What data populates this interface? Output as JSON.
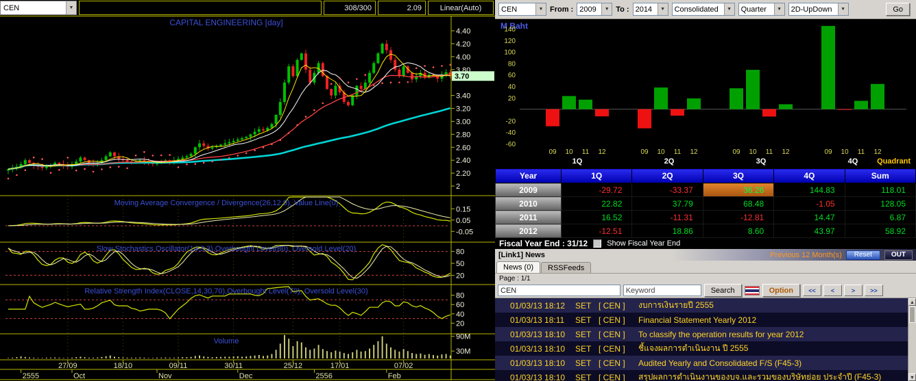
{
  "left_toolbar": {
    "symbol": "CEN",
    "range": "308/300",
    "value": "2.09",
    "scale_mode": "Linear(Auto)"
  },
  "price_chart": {
    "title": "CAPITAL ENGINEERING [day]",
    "current_price": "3.70",
    "price_ticks": [
      "4.40",
      "4.20",
      "4.00",
      "3.80",
      "3.40",
      "3.20",
      "3.00",
      "2.80",
      "2.60",
      "2.40",
      "2.20",
      "2"
    ],
    "macd_title": "Moving Average Convergence / Divergence(26,12,9), Value Line(0)",
    "macd_ticks": [
      "0.15",
      "0.05",
      "-0.05"
    ],
    "stoch_title": "Slow Stochastics Oscillator(14,3,3),Overbought Level(80), Oversold Level(20)",
    "stoch_ticks": [
      "80",
      "50",
      "20"
    ],
    "rsi_title": "Relative Strength Index(CLOSE,14,30,70),Overbought Level(70), Oversold Level(30)",
    "rsi_ticks": [
      "80",
      "60",
      "40",
      "20"
    ],
    "volume_title": "Volume",
    "volume_ticks": [
      "90M",
      "30M"
    ]
  },
  "chart_data": [
    {
      "type": "candlestick",
      "symbol": "CEN",
      "title": "CAPITAL ENGINEERING [day]",
      "last_price": 3.7,
      "ylim": [
        2.0,
        4.4
      ],
      "closes": [
        2.26,
        2.28,
        2.3,
        2.34,
        2.4,
        2.36,
        2.32,
        2.3,
        2.28,
        2.3,
        2.32,
        2.36,
        2.34,
        2.32,
        2.3,
        2.34,
        2.38,
        2.44,
        2.4,
        2.36,
        2.34,
        2.36,
        2.4,
        2.46,
        2.52,
        2.46,
        2.42,
        2.4,
        2.38,
        2.36,
        2.38,
        2.4,
        2.38,
        2.36,
        2.34,
        2.36,
        2.38,
        2.4,
        2.38,
        2.4,
        2.42,
        2.44,
        2.46,
        2.5,
        2.6,
        2.66,
        2.62,
        2.58,
        2.6,
        2.62,
        2.64,
        2.66,
        2.68,
        2.7,
        2.72,
        2.74,
        2.76,
        2.8,
        2.84,
        2.88,
        2.86,
        2.9,
        2.96,
        3.1,
        3.3,
        3.6,
        3.85,
        3.7,
        3.95,
        4.05,
        3.8,
        3.6,
        3.75,
        3.9,
        3.7,
        3.5,
        3.4,
        3.55,
        3.45,
        3.3,
        3.25,
        3.4,
        3.55,
        3.5,
        3.6,
        3.75,
        3.9,
        4.05,
        4.2,
        4.1,
        3.95,
        3.8,
        3.7,
        3.85,
        3.75,
        3.65,
        3.7,
        3.75,
        3.68,
        3.72,
        3.7,
        3.66,
        3.72,
        3.76,
        3.7
      ],
      "volumes_millions": [
        2,
        3,
        5,
        8,
        6,
        4,
        3,
        2,
        2,
        3,
        3,
        4,
        3,
        2,
        2,
        3,
        5,
        7,
        5,
        3,
        3,
        4,
        6,
        9,
        12,
        7,
        5,
        4,
        3,
        3,
        3,
        4,
        3,
        2,
        2,
        3,
        3,
        4,
        3,
        3,
        4,
        5,
        5,
        6,
        10,
        12,
        8,
        6,
        5,
        6,
        6,
        7,
        7,
        8,
        9,
        7,
        8,
        10,
        12,
        14,
        10,
        12,
        18,
        35,
        60,
        95,
        80,
        50,
        70,
        65,
        45,
        35,
        40,
        55,
        38,
        30,
        25,
        32,
        28,
        22,
        18,
        25,
        35,
        28,
        30,
        40,
        55,
        70,
        90,
        60,
        45,
        35,
        28,
        38,
        30,
        22,
        18,
        20,
        15,
        18,
        14,
        12,
        16,
        18,
        12
      ],
      "date_ticks": [
        {
          "label": "27/09",
          "i": 14
        },
        {
          "label": "18/10",
          "i": 27
        },
        {
          "label": "09/11",
          "i": 40
        },
        {
          "label": "30/11",
          "i": 53
        },
        {
          "label": "25/12",
          "i": 67
        },
        {
          "label": "17/01",
          "i": 78
        },
        {
          "label": "07/02",
          "i": 93
        }
      ],
      "period_ticks": [
        {
          "label": "2555",
          "i": 3
        },
        {
          "label": "Oct",
          "i": 15
        },
        {
          "label": "Nov",
          "i": 35
        },
        {
          "label": "Dec",
          "i": 54
        },
        {
          "label": "2556",
          "i": 72
        },
        {
          "label": "Feb",
          "i": 89
        }
      ]
    },
    {
      "type": "bar",
      "title": "M Baht",
      "ylabel": "M Baht",
      "categories": [
        "1Q",
        "2Q",
        "3Q",
        "4Q"
      ],
      "x_year_labels": [
        "09",
        "10",
        "11",
        "12"
      ],
      "series": [
        {
          "name": "2009",
          "values": [
            -29.72,
            -33.37,
            36.26,
            144.83
          ]
        },
        {
          "name": "2010",
          "values": [
            22.82,
            37.79,
            68.48,
            -1.05
          ]
        },
        {
          "name": "2011",
          "values": [
            16.52,
            -11.31,
            -12.81,
            14.47
          ]
        },
        {
          "name": "2012",
          "values": [
            -12.51,
            18.86,
            8.6,
            43.97
          ]
        }
      ],
      "ylim": [
        -60,
        140
      ],
      "y_ticks": [
        140,
        120,
        100,
        80,
        60,
        40,
        20,
        -20,
        -40,
        -60
      ],
      "quadrant_label": "Quadrant",
      "positive_color": "#00a000",
      "negative_color": "#ee1111"
    }
  ],
  "right_toolbar": {
    "symbol": "CEN",
    "from_label": "From :",
    "from_value": "2009",
    "to_label": "To :",
    "to_value": "2014",
    "report_type": "Consolidated",
    "period": "Quarter",
    "chart_type": "2D-UpDown",
    "go_label": "Go"
  },
  "table": {
    "headers": [
      "Year",
      "1Q",
      "2Q",
      "3Q",
      "4Q",
      "Sum"
    ],
    "rows": [
      {
        "year": "2009",
        "values": [
          "-29.72",
          "-33.37",
          "36.26",
          "144.83",
          "118.01"
        ],
        "highlight_col": 2
      },
      {
        "year": "2010",
        "values": [
          "22.82",
          "37.79",
          "68.48",
          "-1.05",
          "128.05"
        ]
      },
      {
        "year": "2011",
        "values": [
          "16.52",
          "-11.31",
          "-12.81",
          "14.47",
          "6.87"
        ]
      },
      {
        "year": "2012",
        "values": [
          "-12.51",
          "18.86",
          "8.60",
          "43.97",
          "58.92"
        ]
      }
    ]
  },
  "fiscal": {
    "label": "Fiscal  Year  End :  31/12",
    "checkbox_label": "Show Fiscal Year End"
  },
  "news_panel": {
    "titlebar": "[Link1] News",
    "previous_label": "Previous 12 Month(s)",
    "reset_label": "Reset",
    "out_label": "OUT",
    "tabs": [
      "News (0)",
      "RSSFeeds"
    ],
    "page_label": "Page : 1/1",
    "search_symbol": "CEN",
    "keyword_placeholder": "Keyword",
    "search_label": "Search",
    "option_label": "Option",
    "nav": [
      "<<",
      "<",
      ">",
      ">>"
    ],
    "items": [
      {
        "time": "01/03/13 18:12",
        "source": "SET",
        "symbol": "[ CEN ]",
        "headline": "งบการเงินรายปี 2555"
      },
      {
        "time": "01/03/13 18:11",
        "source": "SET",
        "symbol": "[ CEN ]",
        "headline": "Financial Statement Yearly 2012"
      },
      {
        "time": "01/03/13 18:10",
        "source": "SET",
        "symbol": "[ CEN ]",
        "headline": "To classify the operation results for year 2012"
      },
      {
        "time": "01/03/13 18:10",
        "source": "SET",
        "symbol": "[ CEN ]",
        "headline": "ชี้แจงผลการดำเนินงาน ปี 2555"
      },
      {
        "time": "01/03/13 18:10",
        "source": "SET",
        "symbol": "[ CEN ]",
        "headline": "Audited Yearly and Consolidated F/S (F45-3)"
      },
      {
        "time": "01/03/13 18:10",
        "source": "SET",
        "symbol": "[ CEN ]",
        "headline": "สรุปผลการดำเนินงานของบจ.และรวมของบริษัทย่อย ประจำปี (F45-3)"
      }
    ]
  }
}
